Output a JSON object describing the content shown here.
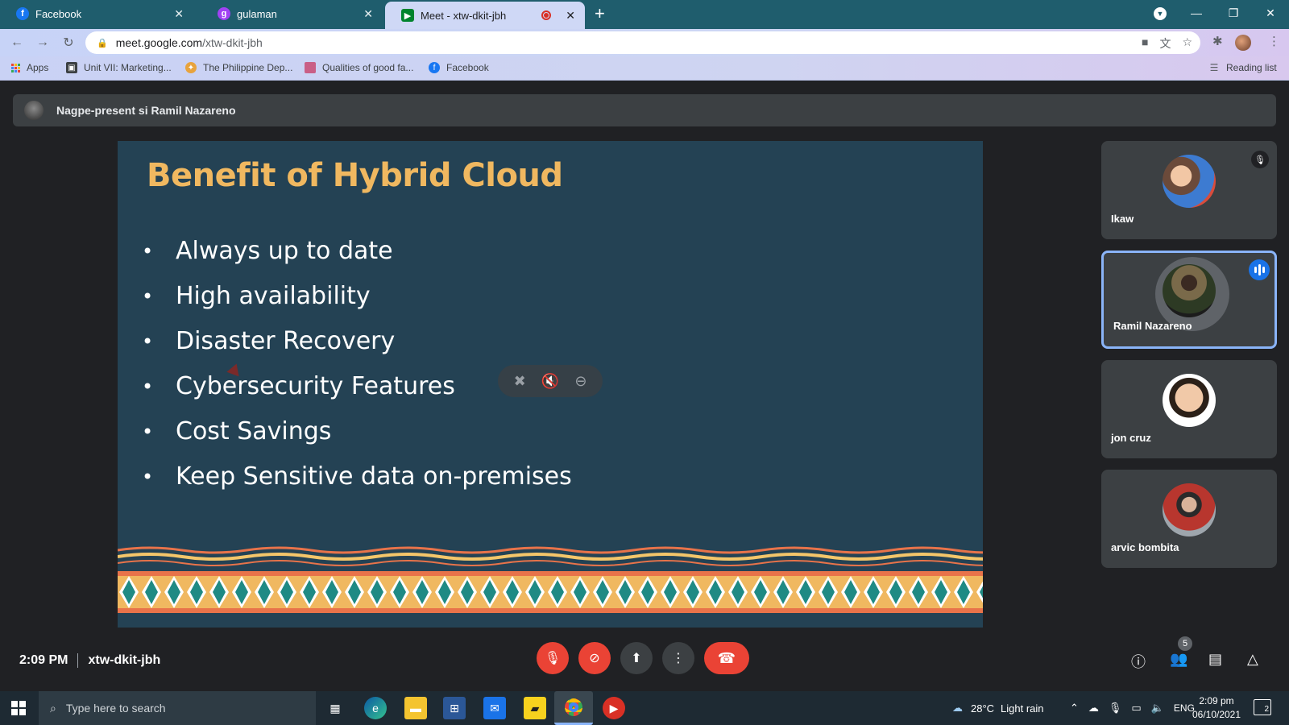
{
  "browser": {
    "tabs": [
      {
        "title": "Facebook",
        "icon": "facebook-icon"
      },
      {
        "title": "gulaman",
        "icon": "chrome-app-icon"
      },
      {
        "title": "Meet - xtw-dkit-jbh",
        "icon": "google-meet-icon"
      }
    ],
    "url": {
      "host": "meet.google.com",
      "path": "/xtw-dkit-jbh"
    },
    "bookmarks": [
      {
        "label": "Apps",
        "icon": "apps-grid-icon"
      },
      {
        "label": "Unit VII: Marketing...",
        "icon": "bookmark-doc-icon"
      },
      {
        "label": "The Philippine Dep...",
        "icon": "bookmark-flag-icon"
      },
      {
        "label": "Qualities of good fa...",
        "icon": "bookmark-pink-icon"
      },
      {
        "label": "Facebook",
        "icon": "facebook-icon"
      }
    ],
    "reading_list": "Reading list",
    "colors": {
      "frame": "#1f5d6d",
      "toolbar": "#cdd6f4"
    }
  },
  "meet": {
    "presenter_text": "Nagpe-present si Ramil Nazareno",
    "slide": {
      "title": "Benefit of Hybrid Cloud",
      "bullets": [
        "Always up to date",
        "High availability",
        "Disaster Recovery",
        "Cybersecurity Features",
        "Cost Savings",
        "Keep Sensitive data on-premises"
      ],
      "colors": {
        "background": "#244254",
        "title": "#f0b860"
      }
    },
    "participants": [
      {
        "name": "Ikaw",
        "muted": true,
        "speaking": false
      },
      {
        "name": "Ramil Nazareno",
        "muted": false,
        "speaking": true
      },
      {
        "name": "jon cruz",
        "muted": false,
        "speaking": false
      },
      {
        "name": "arvic bombita",
        "muted": false,
        "speaking": false
      }
    ],
    "meeting_time": "2:09 PM",
    "meeting_code": "xtw-dkit-jbh",
    "participant_count": "5",
    "colors": {
      "accent": "#8ab4f8",
      "danger": "#ea4335"
    }
  },
  "taskbar": {
    "search_placeholder": "Type here to search",
    "weather_temp": "28°C",
    "weather_desc": "Light rain",
    "language": "ENG",
    "time": "2:09 pm",
    "date": "06/10/2021",
    "notifications": "2"
  }
}
